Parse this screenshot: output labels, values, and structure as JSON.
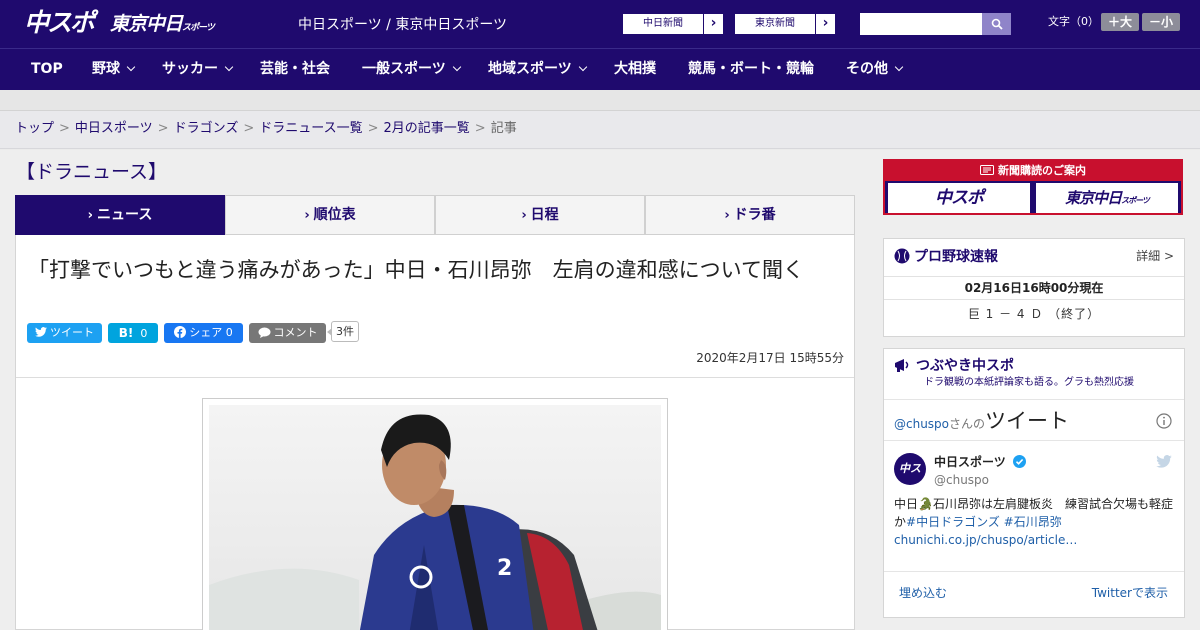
{
  "header": {
    "logo_primary": "中スポ",
    "logo_secondary": "東京中日",
    "logo_secondary_small": "スポーツ",
    "site_name": "中日スポーツ / 東京中日スポーツ",
    "paper_links": [
      {
        "label": "中日新聞",
        "arrow": "›"
      },
      {
        "label": "東京新聞",
        "arrow": "›"
      }
    ],
    "search": {
      "placeholder": "",
      "value": ""
    },
    "font_size": {
      "label": "文字（0）",
      "increase": "＋大",
      "decrease": "－小"
    }
  },
  "nav": {
    "items": [
      {
        "label": "TOP",
        "dropdown": false
      },
      {
        "label": "野球",
        "dropdown": true
      },
      {
        "label": "サッカー",
        "dropdown": true
      },
      {
        "label": "芸能・社会",
        "dropdown": false
      },
      {
        "label": "一般スポーツ",
        "dropdown": true
      },
      {
        "label": "地域スポーツ",
        "dropdown": true
      },
      {
        "label": "大相撲",
        "dropdown": false
      },
      {
        "label": "競馬・ボート・競輪",
        "dropdown": false
      },
      {
        "label": "その他",
        "dropdown": true
      }
    ]
  },
  "breadcrumb": {
    "items": [
      "トップ",
      "中日スポーツ",
      "ドラゴンズ",
      "ドラニュース一覧",
      "2月の記事一覧"
    ],
    "current": "記事",
    "separator": ">"
  },
  "section": {
    "title": "【ドラニュース】"
  },
  "tabs": [
    {
      "label": "ニュース",
      "active": true
    },
    {
      "label": "順位表",
      "active": false
    },
    {
      "label": "日程",
      "active": false
    },
    {
      "label": "ドラ番",
      "active": false
    }
  ],
  "article": {
    "headline": "「打撃でいつもと違う痛みがあった」中日・石川昂弥　左肩の違和感について聞く",
    "share": {
      "tweet": "ツイート",
      "hatena_label": "B!",
      "hatena_count": "0",
      "facebook_label": "シェア",
      "facebook_count": "0",
      "comment": "コメント",
      "comment_count": "3件"
    },
    "date": "2020年2月17日 15時55分"
  },
  "sidebar": {
    "subscribe": {
      "title": "新聞購読のご案内",
      "paper1": "中スポ",
      "paper2": "東京中日",
      "paper2_small": "スポーツ"
    },
    "pro_baseball": {
      "title": "プロ野球速報",
      "more": "詳細 >",
      "time": "02月16日16時00分現在",
      "score": "巨 1 － 4 Ｄ （終了）"
    },
    "tweets": {
      "title": "つぶやき中スポ",
      "subtitle": "ドラ観戦の本紙評論家も語る。グラも熱烈応援",
      "account_handle": "@chuspo",
      "account_suffix": "さんの",
      "heading": "ツイート",
      "avatar_text": "中ス",
      "tweet_name": "中日スポーツ",
      "tweet_handle": "@chuspo",
      "tweet_text": "中日🐊石川昂弥は左肩腱板炎　練習試合欠場も軽症か",
      "tweet_tags": "#中日ドラゴンズ #石川昂弥",
      "tweet_link": "chunichi.co.jp/chuspo/article…",
      "embed": "埋め込む",
      "view_on_twitter": "Twitterで表示"
    }
  },
  "colors": {
    "brand": "#1f0a6e",
    "accent_red": "#c8102e",
    "twitter": "#1da1f2",
    "hatena": "#00a4de",
    "facebook": "#1877f2",
    "comment": "#777777"
  }
}
